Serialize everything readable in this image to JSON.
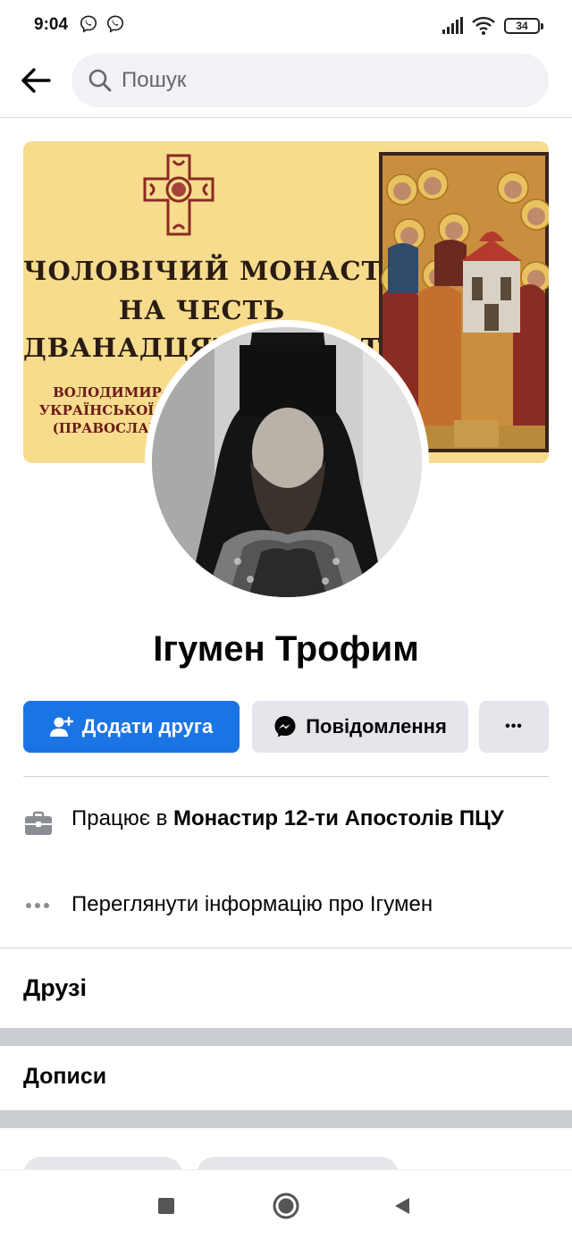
{
  "status_bar": {
    "time": "9:04",
    "battery": "34",
    "icons": [
      "viber-icon",
      "viber-icon",
      "signal-icon",
      "wifi-icon",
      "battery-icon"
    ]
  },
  "header": {
    "back_icon": "arrow-left-icon",
    "search_icon": "search-icon",
    "search_placeholder": "Пошук"
  },
  "cover": {
    "line1": "ЧОЛОВІЧИЙ МОНАСТИР",
    "line2": "НА ЧЕСТЬ",
    "line3": "ДВАНАДЦЯТИ АПОСТОЛІВ",
    "line4": "ВОЛОДИМИР-ВОЛИНСЬКОЇ ЄПАРХІЇ",
    "line5": "УКРАЇНСЬКОЇ ПРАВОСЛАВНОЇ ЦЕРКВИ",
    "line6": "(ПРАВОСЛАВНОЇ ЦЕРКВИ УКРАЇНИ)"
  },
  "profile": {
    "name": "Ігумен Трофим"
  },
  "actions": {
    "add_friend": "Додати друга",
    "add_friend_icon": "add-friend-icon",
    "message": "Повідомлення",
    "message_icon": "messenger-icon",
    "more": "•••"
  },
  "info": {
    "work_prefix": "Працює в ",
    "work_place": "Монастир 12-ти Апостолів ПЦУ",
    "work_icon": "briefcase-icon",
    "see_about": "Переглянути інформацію про Ігумен",
    "see_about_icon": "more-dots-icon"
  },
  "sections": {
    "friends": "Друзі",
    "posts": "Дописи"
  },
  "nav": {
    "recents_icon": "square-icon",
    "home_icon": "circle-icon",
    "back_icon": "triangle-back-icon"
  },
  "colors": {
    "accent": "#1b74e4",
    "button_gray": "#e4e6eb",
    "cover_bg": "#f7dc8e"
  }
}
